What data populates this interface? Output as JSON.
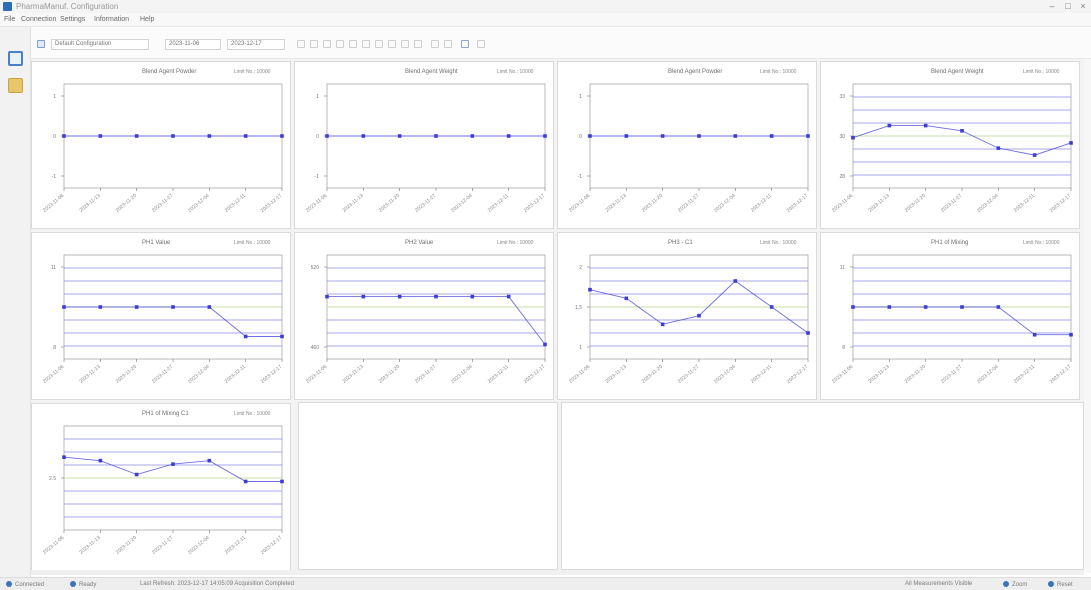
{
  "window": {
    "title": "PharmaManuf. Configuration",
    "controls": [
      "–",
      "□",
      "×"
    ]
  },
  "menu": [
    "File",
    "Connection",
    "Settings",
    "Information",
    "Help"
  ],
  "sidebar": {
    "icons": [
      "chart-grid-icon",
      "folder-icon"
    ]
  },
  "toolbar": {
    "configuration_select": "Default Configuration",
    "date_from": "2023-11-06",
    "date_to": "2023-12-17",
    "icons": [
      "first-icon",
      "prev-icon",
      "next-icon",
      "last-icon",
      "zoom-in-icon",
      "zoom-out-icon",
      "refresh-icon",
      "export-icon",
      "print-icon",
      "settings-icon",
      "layout-icon",
      "save-icon",
      "grid-icon",
      "table-icon"
    ]
  },
  "charts": [
    {
      "title": "Blend Agent Powder",
      "limit": "Limit No.: 10000",
      "chart_data": {
        "type": "line",
        "x": [
          "2023-11-06",
          "2023-11-13",
          "2023-11-20",
          "2023-11-27",
          "2023-12-04",
          "2023-12-11",
          "2023-12-17"
        ],
        "y": [
          0,
          0,
          0,
          0,
          0,
          0,
          0
        ],
        "ylim": [
          -1,
          1
        ],
        "yticks": [
          "1",
          "0",
          "-1"
        ],
        "bands": false
      }
    },
    {
      "title": "Blend Agent Weight",
      "limit": "Limit No.: 10000",
      "chart_data": {
        "type": "line",
        "x": [
          "2023-11-06",
          "2023-11-13",
          "2023-11-20",
          "2023-11-27",
          "2023-12-04",
          "2023-12-11",
          "2023-12-17"
        ],
        "y": [
          0,
          0,
          0,
          0,
          0,
          0,
          0
        ],
        "ylim": [
          -1,
          1
        ],
        "yticks": [
          "1",
          "0",
          "-1"
        ],
        "bands": false
      }
    },
    {
      "title": "Blend Agent Powder",
      "limit": "Limit No.: 10000",
      "chart_data": {
        "type": "line",
        "x": [
          "2023-11-06",
          "2023-11-13",
          "2023-11-20",
          "2023-11-27",
          "2023-12-04",
          "2023-12-11",
          "2023-12-17"
        ],
        "y": [
          0,
          0,
          0,
          0,
          0,
          0,
          0
        ],
        "ylim": [
          -1,
          1
        ],
        "yticks": [
          "1",
          "0",
          "-1"
        ],
        "bands": false
      }
    },
    {
      "title": "Blend Agent Weight",
      "limit": "Limit No.: 10000",
      "chart_data": {
        "type": "line",
        "x": [
          "2023-11-06",
          "2023-11-13",
          "2023-11-20",
          "2023-11-27",
          "2023-12-04",
          "2023-12-11",
          "2023-12-17"
        ],
        "y": [
          30.4,
          31.1,
          31.1,
          30.8,
          29.8,
          29.4,
          30.1
        ],
        "ylim": [
          27.5,
          33.5
        ],
        "yticks": [
          "33",
          "30",
          "28"
        ],
        "bands": true
      }
    },
    {
      "title": "PH1 Value",
      "limit": "Limit No.: 10000",
      "chart_data": {
        "type": "line",
        "x": [
          "2023-11-06",
          "2023-11-13",
          "2023-11-20",
          "2023-11-27",
          "2023-12-04",
          "2023-12-11",
          "2023-12-17"
        ],
        "y": [
          9.0,
          9.0,
          9.0,
          9.0,
          9.0,
          7.3,
          7.3
        ],
        "ylim": [
          6.0,
          12.0
        ],
        "yticks": [
          "11",
          "8"
        ],
        "bands": true
      }
    },
    {
      "title": "PH2 Value",
      "limit": "Limit No.: 10000",
      "chart_data": {
        "type": "line",
        "x": [
          "2023-11-06",
          "2023-11-13",
          "2023-11-20",
          "2023-11-27",
          "2023-12-04",
          "2023-12-11",
          "2023-12-17"
        ],
        "y": [
          500,
          500,
          500,
          500,
          500,
          500,
          454
        ],
        "ylim": [
          440,
          540
        ],
        "yticks": [
          "520",
          "460"
        ],
        "bands": true
      }
    },
    {
      "title": "PH3 - C1",
      "limit": "Limit No.: 10000",
      "chart_data": {
        "type": "line",
        "x": [
          "2023-11-06",
          "2023-11-13",
          "2023-11-20",
          "2023-11-27",
          "2023-12-04",
          "2023-12-11",
          "2023-12-17"
        ],
        "y": [
          1.8,
          1.7,
          1.4,
          1.5,
          1.9,
          1.6,
          1.3
        ],
        "ylim": [
          1.0,
          2.2
        ],
        "yticks": [
          "2",
          "1.5",
          "1"
        ],
        "bands": true
      }
    },
    {
      "title": "PH1 of Mixing",
      "limit": "Limit No.: 10000",
      "chart_data": {
        "type": "line",
        "x": [
          "2023-11-06",
          "2023-11-13",
          "2023-11-20",
          "2023-11-27",
          "2023-12-04",
          "2023-12-11",
          "2023-12-17"
        ],
        "y": [
          9.0,
          9.0,
          9.0,
          9.0,
          9.0,
          7.4,
          7.4
        ],
        "ylim": [
          6.0,
          12.0
        ],
        "yticks": [
          "11",
          "8"
        ],
        "bands": true
      }
    },
    {
      "title": "PH1 of Mixing C1",
      "limit": "Limit No.: 10000",
      "chart_data": {
        "type": "line",
        "x": [
          "2023-11-06",
          "2023-11-13",
          "2023-11-20",
          "2023-11-27",
          "2023-12-04",
          "2023-12-11",
          "2023-12-17"
        ],
        "y": [
          3.1,
          3.0,
          2.6,
          2.9,
          3.0,
          2.4,
          2.4
        ],
        "ylim": [
          1.0,
          4.0
        ],
        "yticks": [
          "2.5"
        ],
        "bands": true
      }
    }
  ],
  "status": {
    "left": [
      "Connected",
      "Ready"
    ],
    "middle": "Last Refresh: 2023-12-17 14:05:09 Acquisition Completed",
    "right": [
      "All Measurements Visible",
      "Zoom",
      "Reset"
    ]
  },
  "colors": {
    "line": "#3d3dd6",
    "band": "#8a8ae8",
    "center": "#b9d68a",
    "axis": "#555555"
  }
}
